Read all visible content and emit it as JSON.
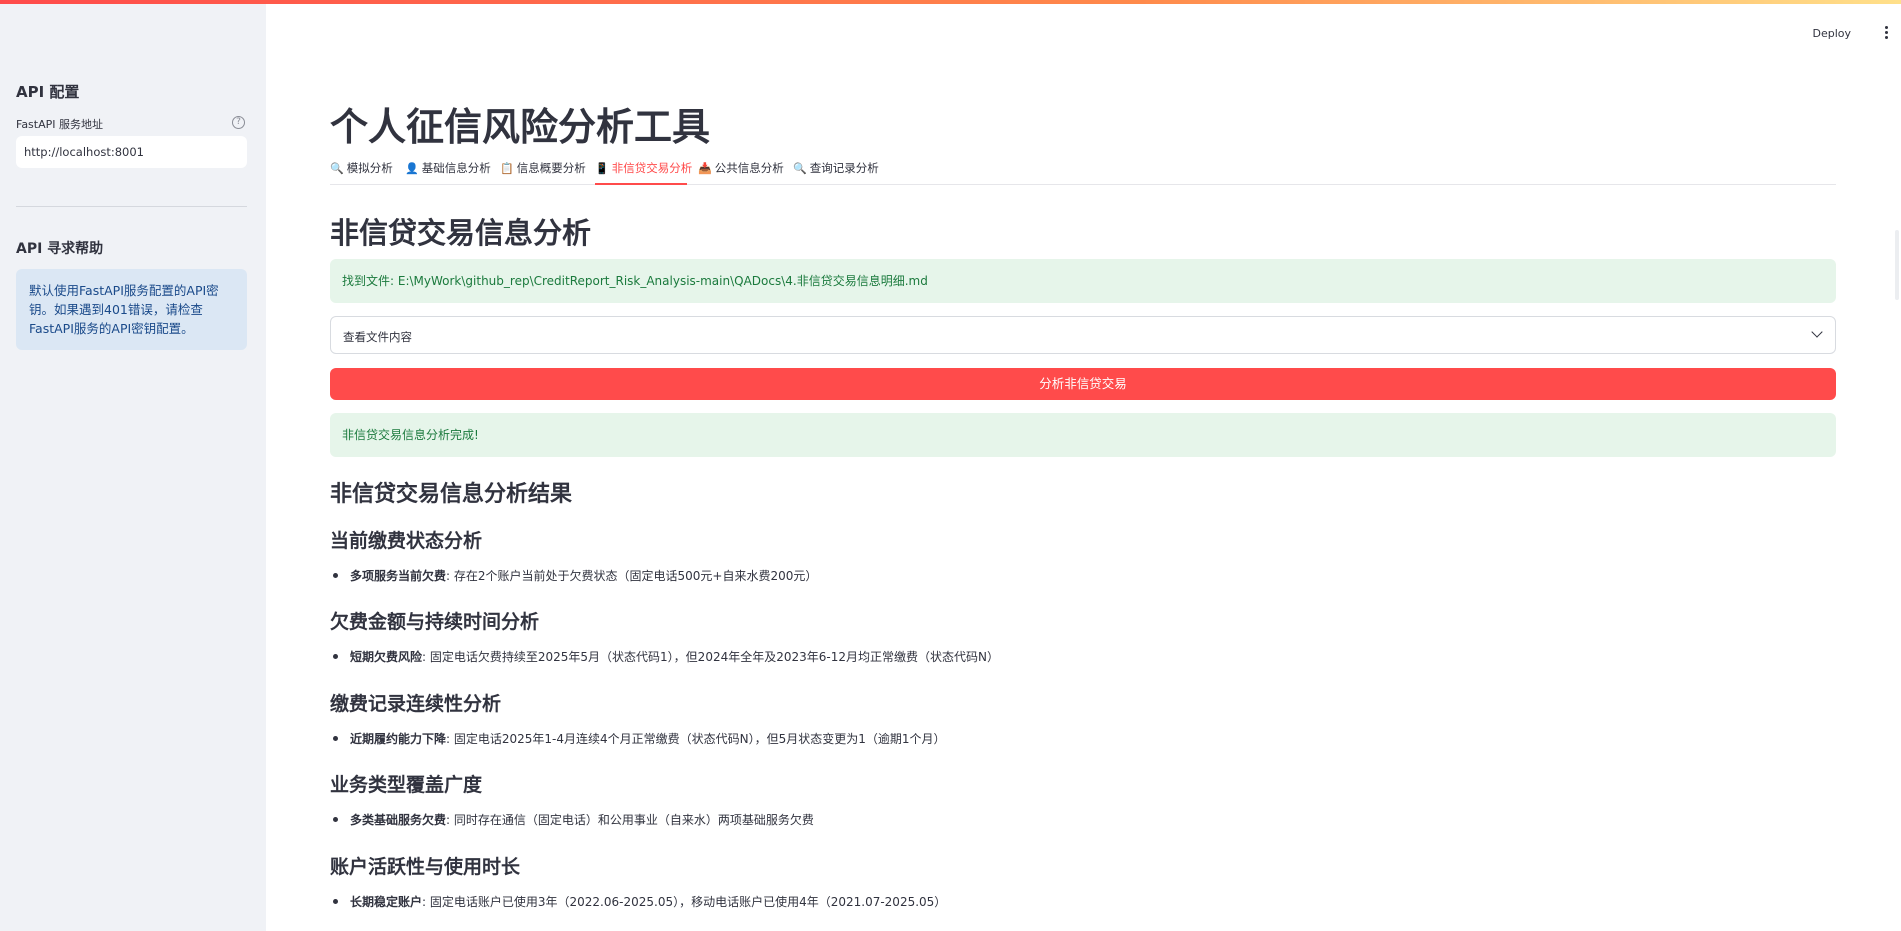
{
  "sidebar": {
    "api_config_title": "API 配置",
    "fastapi_label": "FastAPI 服务地址",
    "help_icon": "?",
    "fastapi_value": "http://localhost:8001",
    "help_title": "API 寻求帮助",
    "help_text": "默认使用FastAPI服务配置的API密钥。如果遇到401错误，请检查FastAPI服务的API密钥配置。"
  },
  "header": {
    "deploy_label": "Deploy",
    "menu_icon": "kebab-menu-icon"
  },
  "main": {
    "title": "个人征信风险分析工具",
    "tabs": [
      {
        "icon": "🔍",
        "icon_name": "magnifier-icon",
        "label": "模拟分析"
      },
      {
        "icon": "👤",
        "icon_name": "user-icon",
        "label": "基础信息分析"
      },
      {
        "icon": "📋",
        "icon_name": "clipboard-icon",
        "label": "信息概要分析"
      },
      {
        "icon": "📱",
        "icon_name": "mobile-phone-icon",
        "label": "非信贷交易分析",
        "active": true
      },
      {
        "icon": "📥",
        "icon_name": "inbox-tray-icon",
        "label": "公共信息分析"
      },
      {
        "icon": "🔍",
        "icon_name": "magnifier-icon",
        "label": "查询记录分析"
      }
    ],
    "section_title": "非信贷交易信息分析",
    "file_found_text": "找到文件: E:\\MyWork\\github_rep\\CreditReport_Risk_Analysis-main\\QADocs\\4.非信贷交易信息明细.md",
    "expander_label": "查看文件内容",
    "analyze_button": "分析非信贷交易",
    "success_text": "非信贷交易信息分析完成!",
    "results_title": "非信贷交易信息分析结果",
    "sections": [
      {
        "heading": "当前缴费状态分析",
        "bold": "多项服务当前欠费",
        "text": ": 存在2个账户当前处于欠费状态（固定电话500元+自来水费200元）"
      },
      {
        "heading": "欠费金额与持续时间分析",
        "bold": "短期欠费风险",
        "text": ": 固定电话欠费持续至2025年5月（状态代码1），但2024年全年及2023年6-12月均正常缴费（状态代码N）"
      },
      {
        "heading": "缴费记录连续性分析",
        "bold": "近期履约能力下降",
        "text": ": 固定电话2025年1-4月连续4个月正常缴费（状态代码N），但5月状态变更为1（逾期1个月）"
      },
      {
        "heading": "业务类型覆盖广度",
        "bold": "多类基础服务欠费",
        "text": ": 同时存在通信（固定电话）和公用事业（自来水）两项基础服务欠费"
      },
      {
        "heading": "账户活跃性与使用时长",
        "bold": "长期稳定账户",
        "text": ": 固定电话账户已使用3年（2022.06-2025.05），移动电话账户已使用4年（2021.07-2025.05）"
      }
    ]
  }
}
